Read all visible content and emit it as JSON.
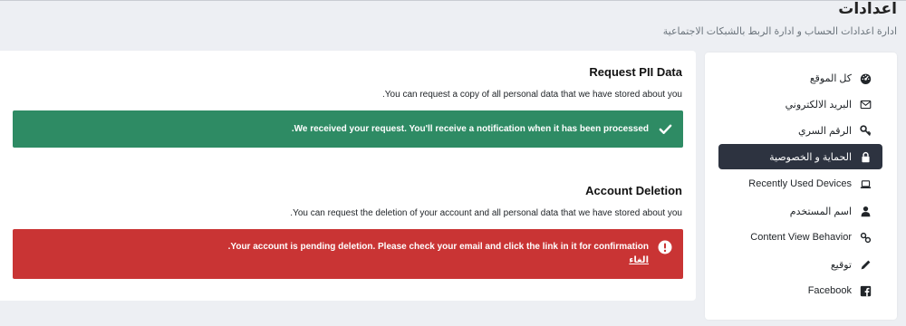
{
  "header": {
    "title": "اعدادات",
    "subtitle": "ادارة اعدادات الحساب و ادارة الربط بالشبكات الاجتماعية"
  },
  "sidebar": {
    "items": [
      {
        "label": "كل الموقع",
        "icon": "dashboard-icon",
        "active": false
      },
      {
        "label": "البريد الالكتروني",
        "icon": "envelope-icon",
        "active": false
      },
      {
        "label": "الرقم السري",
        "icon": "key-icon",
        "active": false
      },
      {
        "label": "الحماية و الخصوصية",
        "icon": "lock-icon",
        "active": true
      },
      {
        "label": "Recently Used Devices",
        "icon": "laptop-icon",
        "active": false
      },
      {
        "label": "اسم المستخدم",
        "icon": "user-icon",
        "active": false
      },
      {
        "label": "Content View Behavior",
        "icon": "link-icon",
        "active": false
      },
      {
        "label": "توقيع",
        "icon": "pencil-icon",
        "active": false
      },
      {
        "label": "Facebook",
        "icon": "facebook-icon",
        "active": false
      }
    ]
  },
  "pii": {
    "title": "Request PII Data",
    "description": "You can request a copy of all personal data that we have stored about you.",
    "alert_text": "We received your request. You'll receive a notification when it has been processed."
  },
  "deletion": {
    "title": "Account Deletion",
    "description": "You can request the deletion of your account and all personal data that we have stored about you.",
    "alert_text": "Your account is pending deletion. Please check your email and click the link in it for confirmation.",
    "cancel_label": "الغاء"
  },
  "colors": {
    "success": "#2e8b64",
    "danger": "#c93434",
    "active_nav": "#2d3340"
  }
}
